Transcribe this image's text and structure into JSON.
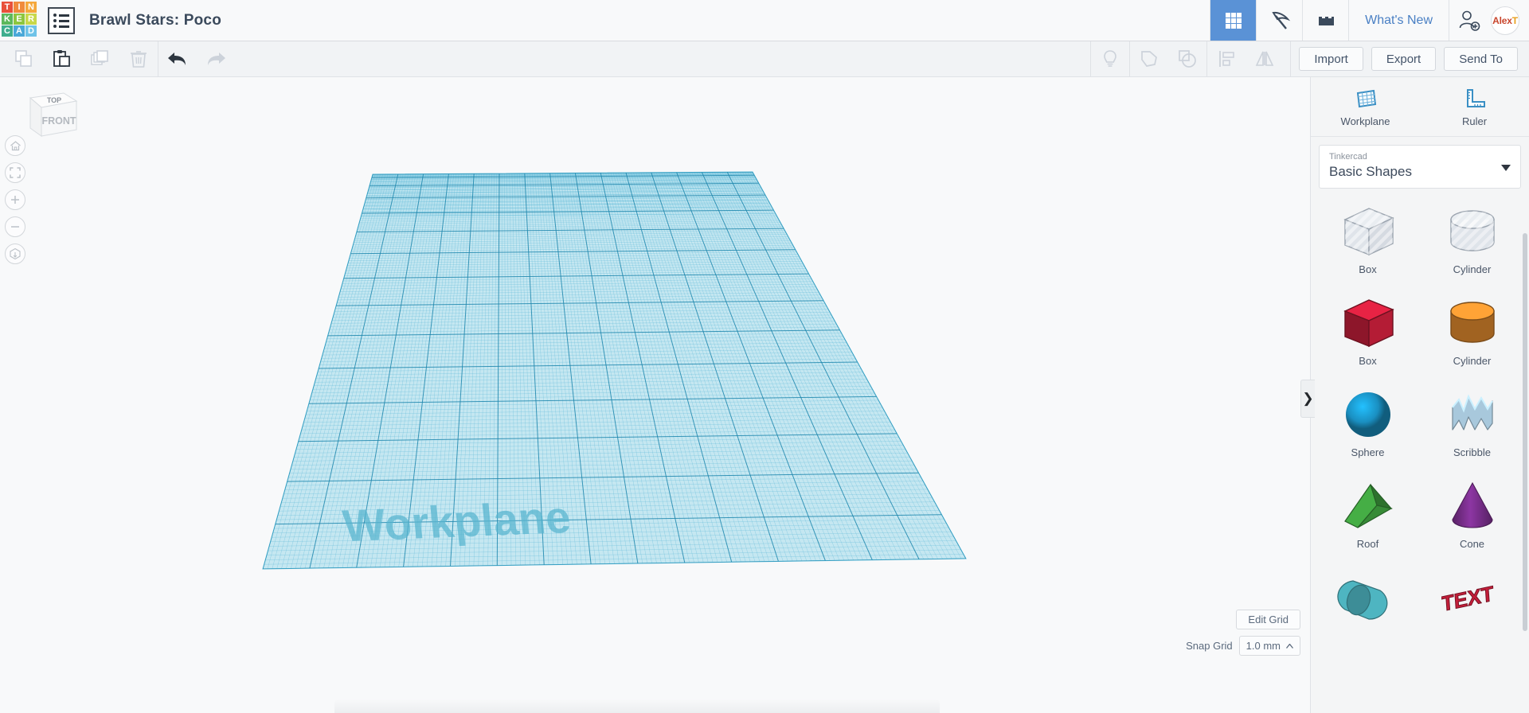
{
  "header": {
    "logo": {
      "name": "tinkercad-logo",
      "tiles": [
        {
          "letter": "T",
          "color": "#e8503a"
        },
        {
          "letter": "I",
          "color": "#f08a3c"
        },
        {
          "letter": "N",
          "color": "#f5a83c"
        },
        {
          "letter": "K",
          "color": "#5cb85c"
        },
        {
          "letter": "E",
          "color": "#8cc63f"
        },
        {
          "letter": "R",
          "color": "#c8d84a"
        },
        {
          "letter": "C",
          "color": "#3fae8e"
        },
        {
          "letter": "A",
          "color": "#4aa8d8"
        },
        {
          "letter": "D",
          "color": "#6fc3e8"
        }
      ]
    },
    "menu_icon": "list-menu-icon",
    "document_title": "Brawl Stars: Poco",
    "buttons": [
      {
        "name": "grid-view-button",
        "icon": "grid-icon",
        "active": true
      },
      {
        "name": "codeblocks-button",
        "icon": "pickaxe-icon",
        "active": false
      },
      {
        "name": "blocks-button",
        "icon": "brick-icon",
        "active": false
      }
    ],
    "whats_new_label": "What's New",
    "invite_icon": "add-person-icon",
    "avatar": {
      "name": "user-avatar",
      "text_primary": "Alex",
      "text_secondary": "T"
    },
    "accent_color": "#5a92d6"
  },
  "toolbar": {
    "left_icons": [
      {
        "name": "copy-icon",
        "label": "Copy",
        "enabled": false
      },
      {
        "name": "paste-icon",
        "label": "Paste",
        "enabled": true
      },
      {
        "name": "duplicate-icon",
        "label": "Duplicate",
        "enabled": false
      },
      {
        "name": "delete-icon",
        "label": "Delete",
        "enabled": false
      }
    ],
    "history_icons": [
      {
        "name": "undo-icon",
        "label": "Undo",
        "enabled": true
      },
      {
        "name": "redo-icon",
        "label": "Redo",
        "enabled": false
      }
    ],
    "right_icons": [
      {
        "name": "lightbulb-icon",
        "label": "Light",
        "enabled": false
      },
      {
        "name": "group-icon",
        "label": "Group",
        "enabled": false
      },
      {
        "name": "ungroup-icon",
        "label": "Ungroup",
        "enabled": false
      },
      {
        "name": "align-icon",
        "label": "Align",
        "enabled": false
      },
      {
        "name": "mirror-icon",
        "label": "Mirror",
        "enabled": false
      }
    ],
    "buttons": [
      {
        "name": "import-button",
        "label": "Import"
      },
      {
        "name": "export-button",
        "label": "Export"
      },
      {
        "name": "send-to-button",
        "label": "Send To"
      }
    ]
  },
  "canvas": {
    "viewcube": {
      "top_face_label": "TOP",
      "front_face_label": "FRONT"
    },
    "nav_buttons": [
      {
        "name": "home-view-button",
        "icon": "home-icon"
      },
      {
        "name": "fit-all-button",
        "icon": "fit-frame-icon"
      },
      {
        "name": "zoom-in-button",
        "icon": "plus-icon"
      },
      {
        "name": "zoom-out-button",
        "icon": "minus-icon"
      },
      {
        "name": "ortho-perspective-button",
        "icon": "cube-view-icon"
      }
    ],
    "workplane_label": "Workplane",
    "workplane_color": "#9fd8ea",
    "grid_line_color": "#34a0c4",
    "edit_grid_label": "Edit Grid",
    "snap_grid_label": "Snap Grid",
    "snap_grid_value": "1.0 mm"
  },
  "panel": {
    "collapse_handle_glyph": "❯",
    "tools": [
      {
        "name": "workplane-tool",
        "label": "Workplane",
        "icon": "workplane-grid-icon"
      },
      {
        "name": "ruler-tool",
        "label": "Ruler",
        "icon": "ruler-icon"
      }
    ],
    "shape_library": {
      "category_label": "Tinkercad",
      "selected": "Basic Shapes"
    },
    "shapes": [
      {
        "name": "shape-box-hole",
        "label": "Box",
        "kind": "box",
        "style": "hole",
        "color": "#c8ced6"
      },
      {
        "name": "shape-cylinder-hole",
        "label": "Cylinder",
        "kind": "cylinder",
        "style": "hole",
        "color": "#c8ced6"
      },
      {
        "name": "shape-box-solid",
        "label": "Box",
        "kind": "box",
        "style": "solid",
        "color": "#c41e3a"
      },
      {
        "name": "shape-cylinder-solid",
        "label": "Cylinder",
        "kind": "cylinder",
        "style": "solid",
        "color": "#e08a2e"
      },
      {
        "name": "shape-sphere",
        "label": "Sphere",
        "kind": "sphere",
        "style": "solid",
        "color": "#1a8fc1"
      },
      {
        "name": "shape-scribble",
        "label": "Scribble",
        "kind": "scribble",
        "style": "solid",
        "color": "#a8c8dc"
      },
      {
        "name": "shape-roof",
        "label": "Roof",
        "kind": "roof",
        "style": "solid",
        "color": "#3f9e3f"
      },
      {
        "name": "shape-cone",
        "label": "Cone",
        "kind": "cone",
        "style": "solid",
        "color": "#7b2f8e"
      },
      {
        "name": "shape-rounded-roof",
        "label": "",
        "kind": "rounded",
        "style": "solid",
        "color": "#4aacb8"
      },
      {
        "name": "shape-text",
        "label": "",
        "kind": "text",
        "style": "solid",
        "color": "#c41e3a"
      }
    ]
  }
}
